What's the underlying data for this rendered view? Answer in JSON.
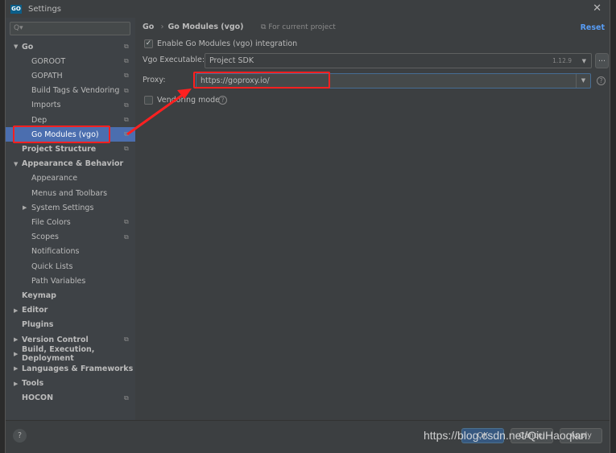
{
  "window": {
    "title": "Settings",
    "logo": "GO"
  },
  "search": {
    "placeholder": "Q▾"
  },
  "tree": [
    {
      "label": "Go",
      "bold": true,
      "expanded": true,
      "level": 0,
      "copy": true
    },
    {
      "label": "GOROOT",
      "level": 1,
      "copy": true
    },
    {
      "label": "GOPATH",
      "level": 1,
      "copy": true
    },
    {
      "label": "Build Tags & Vendoring",
      "level": 1,
      "copy": true
    },
    {
      "label": "Imports",
      "level": 1,
      "copy": true
    },
    {
      "label": "Dep",
      "level": 1,
      "copy": true
    },
    {
      "label": "Go Modules (vgo)",
      "level": 1,
      "copy": true,
      "selected": true
    },
    {
      "label": "Project Structure",
      "bold": true,
      "level": 0,
      "copy": true
    },
    {
      "label": "Appearance & Behavior",
      "bold": true,
      "expanded": true,
      "level": 0
    },
    {
      "label": "Appearance",
      "level": 1
    },
    {
      "label": "Menus and Toolbars",
      "level": 1
    },
    {
      "label": "System Settings",
      "level": 1,
      "collapsed": true
    },
    {
      "label": "File Colors",
      "level": 1,
      "copy": true
    },
    {
      "label": "Scopes",
      "level": 1,
      "copy": true
    },
    {
      "label": "Notifications",
      "level": 1
    },
    {
      "label": "Quick Lists",
      "level": 1
    },
    {
      "label": "Path Variables",
      "level": 1
    },
    {
      "label": "Keymap",
      "bold": true,
      "level": 0
    },
    {
      "label": "Editor",
      "bold": true,
      "level": 0,
      "collapsed": true
    },
    {
      "label": "Plugins",
      "bold": true,
      "level": 0
    },
    {
      "label": "Version Control",
      "bold": true,
      "level": 0,
      "collapsed": true,
      "copy": true
    },
    {
      "label": "Build, Execution, Deployment",
      "bold": true,
      "level": 0,
      "collapsed": true
    },
    {
      "label": "Languages & Frameworks",
      "bold": true,
      "level": 0,
      "collapsed": true
    },
    {
      "label": "Tools",
      "bold": true,
      "level": 0,
      "collapsed": true
    },
    {
      "label": "HOCON",
      "bold": true,
      "level": 0,
      "copy": true
    }
  ],
  "main": {
    "breadcrumb": {
      "parent": "Go",
      "sep": "›",
      "current": "Go Modules (vgo)"
    },
    "for_current_project": "For current project",
    "reset": "Reset",
    "enable_label": "Enable Go Modules (vgo) integration",
    "enable_checked": true,
    "vgo_label": "Vgo Executable:",
    "vgo_value": "Project SDK",
    "vgo_version": "1.12.9",
    "browse": "...",
    "proxy_label": "Proxy:",
    "proxy_value": "https://goproxy.io/",
    "vendoring_label": "Vendoring mode",
    "vendoring_checked": false
  },
  "footer": {
    "ok": "OK",
    "cancel": "Cancel",
    "apply": "Apply",
    "help": "?"
  },
  "watermark": "https://blog.csdn.net/QiuHaoqian",
  "colors": {
    "accent": "#4b6eaf",
    "link": "#589df6",
    "annotation": "#ff2020"
  }
}
